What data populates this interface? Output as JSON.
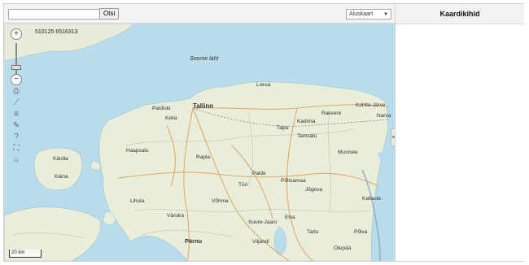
{
  "toolbar": {
    "search_value": "",
    "go_label": "Otsi",
    "basemap_selected": "Aluskaart"
  },
  "sidebar": {
    "title": "Kaardikihid",
    "collapse_icon": "chevron-right-icon"
  },
  "map": {
    "coordinates_display": "510125  6516313",
    "scale_label": "20 km",
    "sea_label": "Soome laht",
    "colors": {
      "sea": "#b8dceb",
      "land": "#e8eed9",
      "road": "#e2a86a"
    },
    "controls": [
      {
        "name": "zoom-in-icon",
        "glyph": "+"
      },
      {
        "name": "zoom-out-icon",
        "glyph": "−"
      },
      {
        "name": "print-icon",
        "glyph": "⎙"
      },
      {
        "name": "measure-line-icon",
        "glyph": "⟋"
      },
      {
        "name": "layers-icon",
        "glyph": "≡"
      },
      {
        "name": "measure-area-icon",
        "glyph": "✎"
      },
      {
        "name": "help-icon",
        "glyph": "?"
      },
      {
        "name": "fullscreen-icon",
        "glyph": "⛶"
      },
      {
        "name": "home-icon",
        "glyph": "⌂"
      }
    ],
    "places": [
      "Tallinn",
      "Loksa",
      "Keila",
      "Paldiski",
      "Rakvere",
      "Kohtla-Järve",
      "Tapa",
      "Kadrina",
      "Haapsalu",
      "Rapla",
      "Paide",
      "Türi",
      "Jõgeva",
      "Narva",
      "Kallaste",
      "Lihula",
      "Pärnu",
      "Suure-Jaani",
      "Viljandi",
      "Tartu",
      "Kärdla",
      "Käina",
      "Vändra",
      "Võhma",
      "Mustvee",
      "Tamsalu",
      "Põltsamaa",
      "Otepää",
      "Elva",
      "Põlva"
    ]
  }
}
